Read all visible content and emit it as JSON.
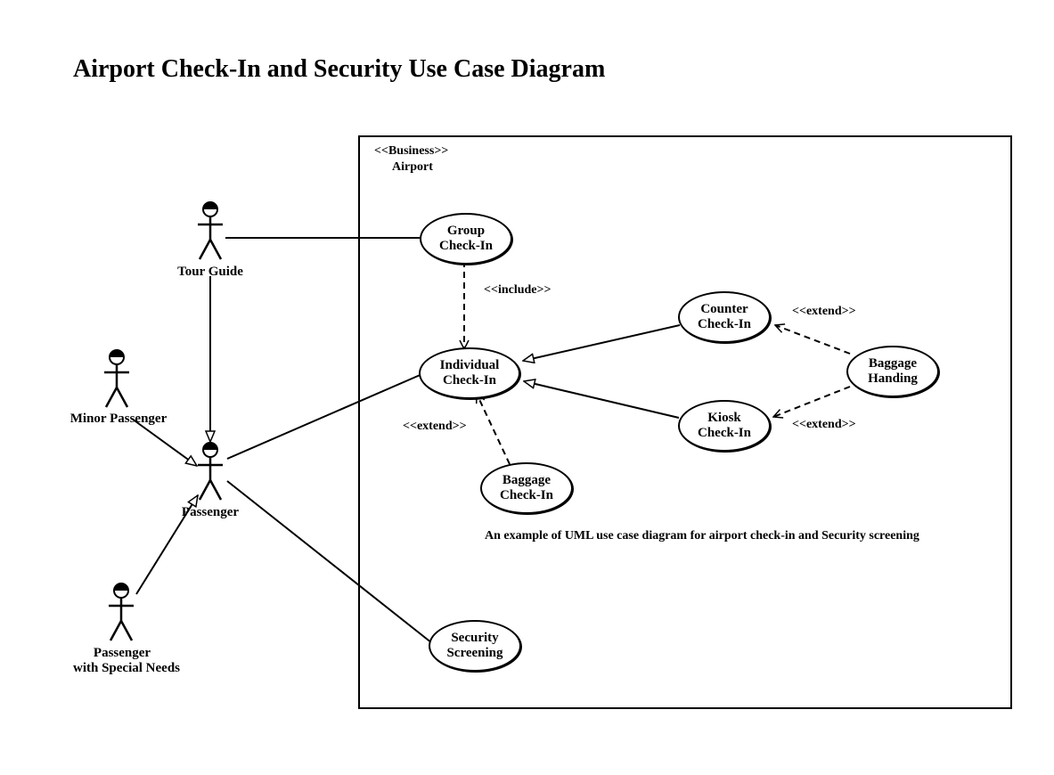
{
  "title": "Airport Check-In and Security Use Case Diagram",
  "system": {
    "stereotype": "<<Business>>",
    "name": "Airport"
  },
  "actors": {
    "tour_guide": "Tour Guide",
    "minor_passenger": "Minor Passenger",
    "passenger": "Passenger",
    "special_needs_line1": "Passenger",
    "special_needs_line2": "with Special Needs"
  },
  "usecases": {
    "group_checkin": "Group\nCheck-In",
    "individual_checkin": "Individual\nCheck-In",
    "counter_checkin": "Counter\nCheck-In",
    "kiosk_checkin": "Kiosk\nCheck-In",
    "baggage_handing": "Baggage\nHanding",
    "baggage_checkin": "Baggage\nCheck-In",
    "security_screening": "Security\nScreening"
  },
  "stereotypes": {
    "include": "<<include>>",
    "extend": "<<extend>>"
  },
  "caption": "An example of UML use case diagram for airport check-in and Security screening"
}
